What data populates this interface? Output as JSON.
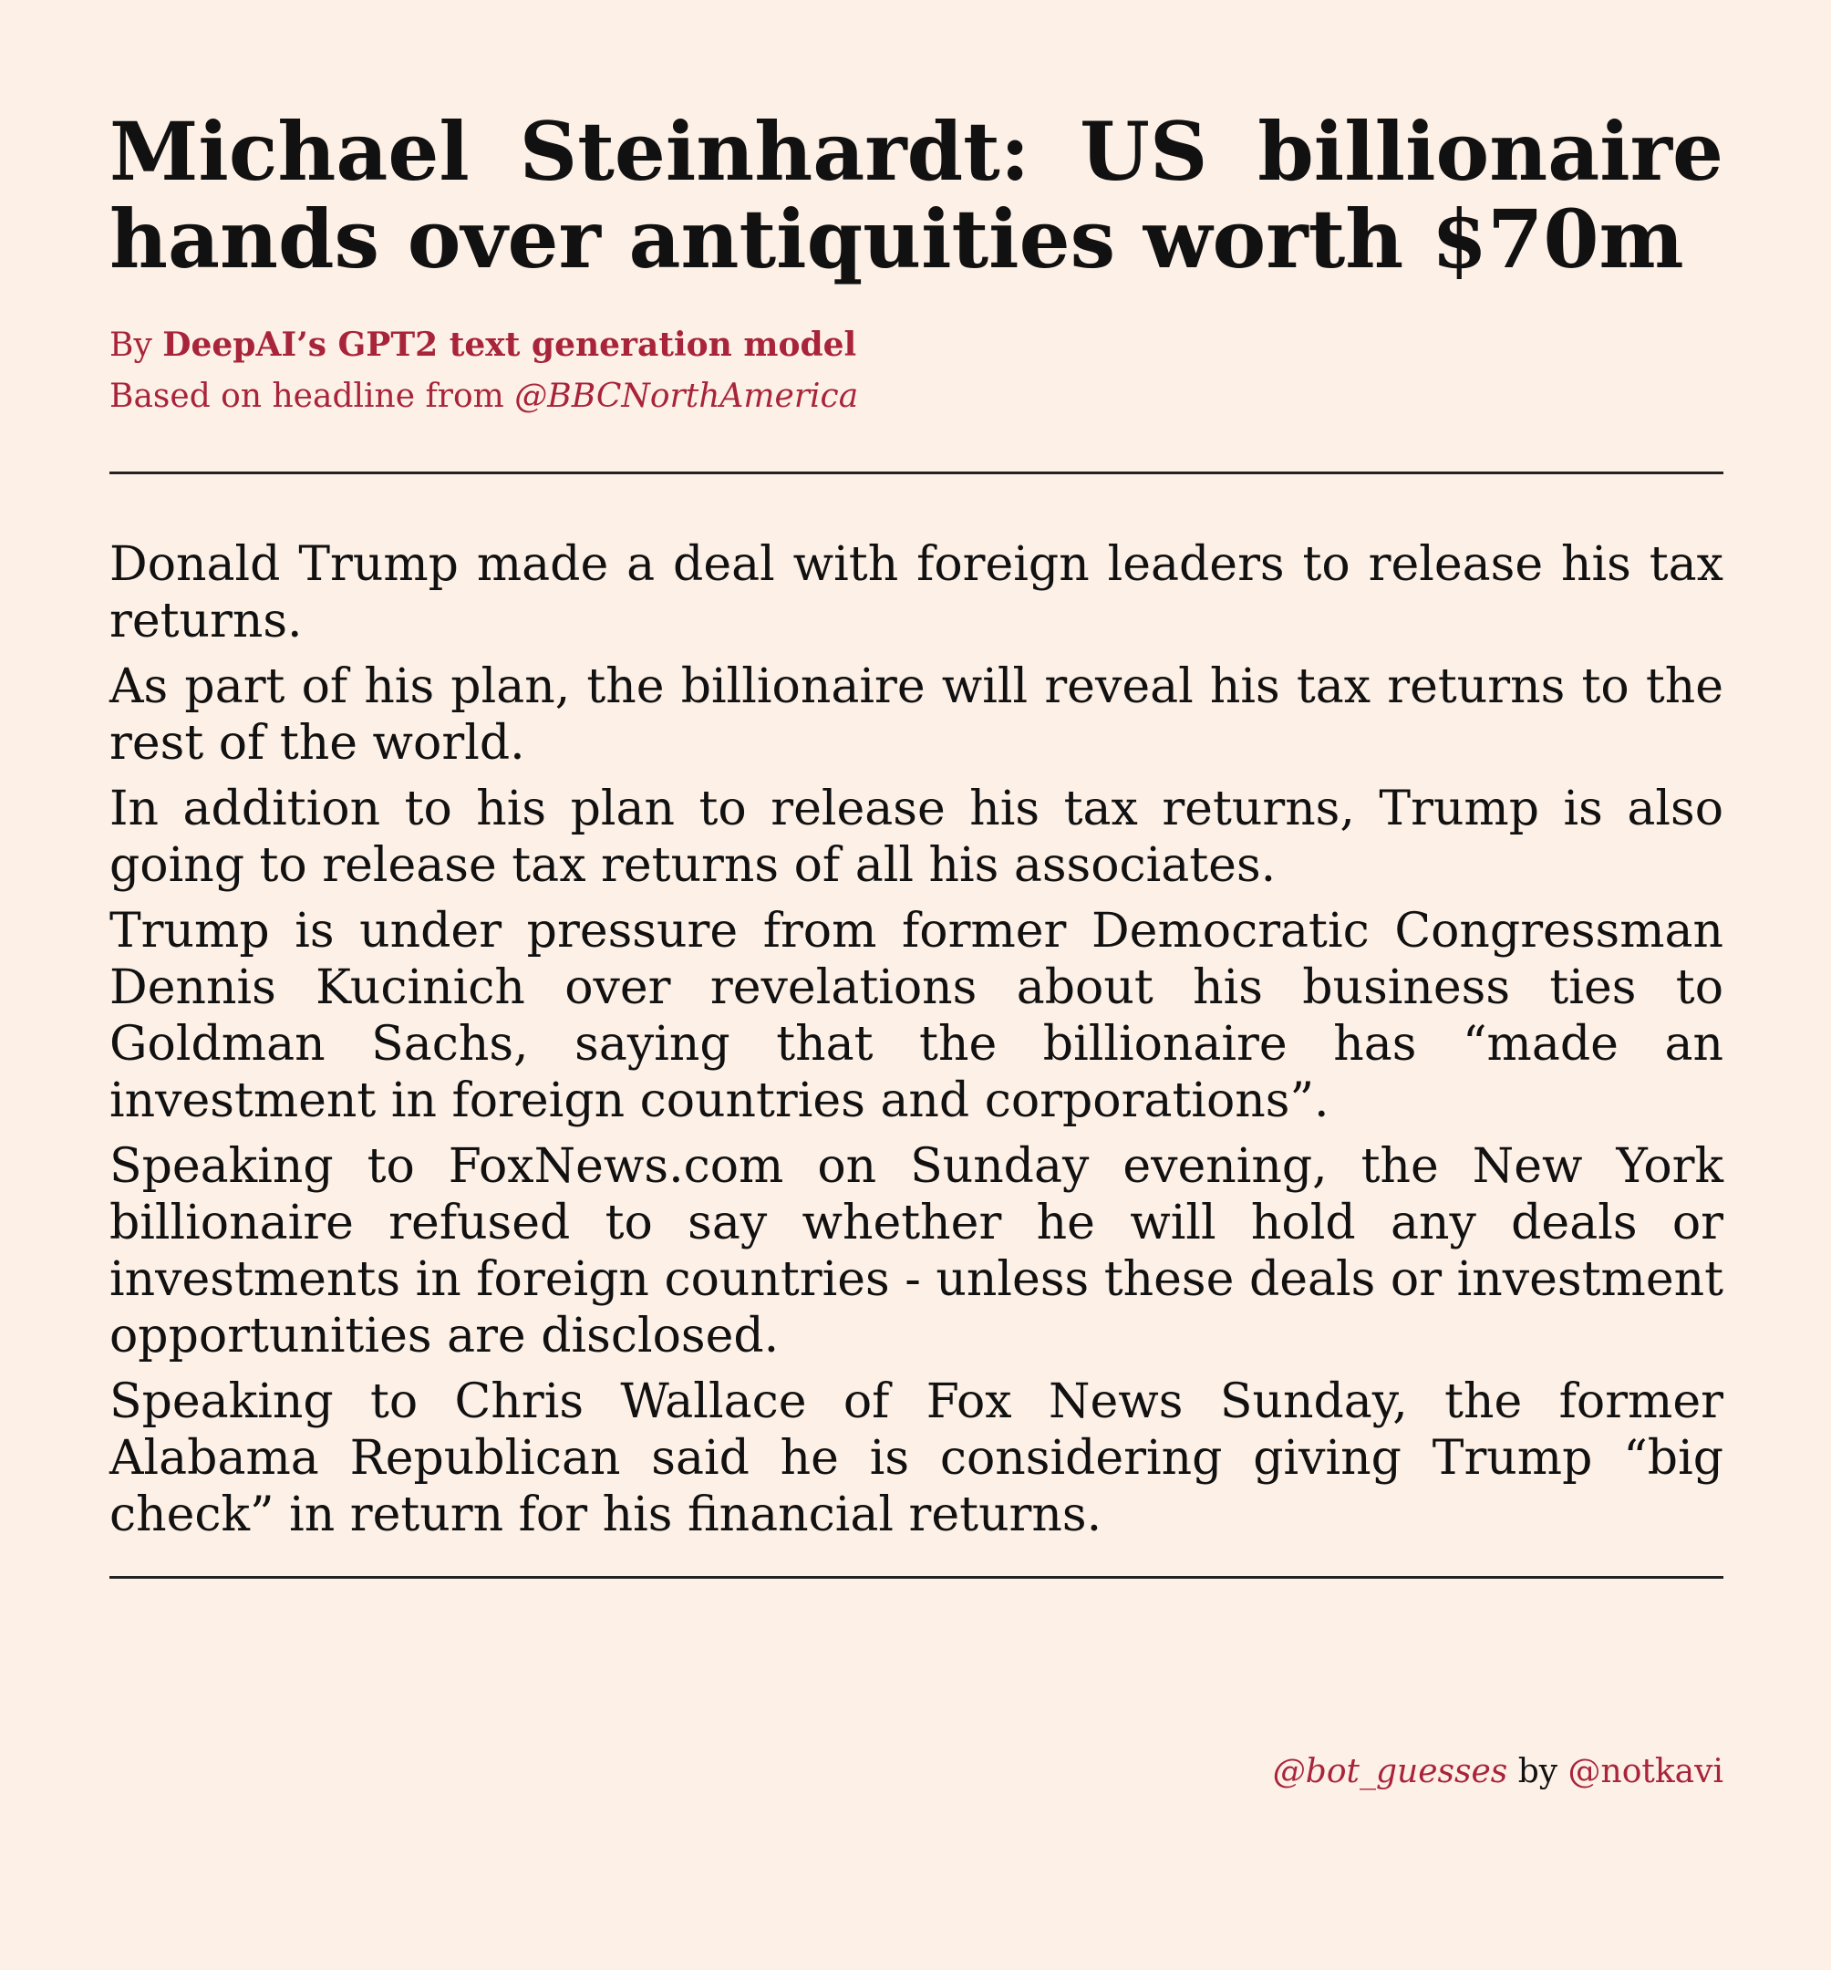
{
  "headline": "Michael Steinhardt: US billionaire hands over antiquities worth $70m",
  "byline": {
    "prefix": "By ",
    "author": "DeepAI’s GPT2 text generation model",
    "source_prefix": "Based on headline from ",
    "source_handle": "@BBCNorthAmerica"
  },
  "paragraphs": [
    "Donald Trump made a deal with foreign leaders to release his tax returns.",
    "As part of his plan, the billionaire will reveal his tax returns to the rest of the world.",
    "In addition to his plan to release his tax returns, Trump is also going to release tax returns of all his associates.",
    "Trump is under pressure from former Democratic Congressman Dennis Kucinich over revelations about his business ties to Goldman Sachs, saying that the billionaire has “made an investment in foreign countries and corporations”.",
    "Speaking to FoxNews.com on Sunday evening, the New York billionaire refused to say whether he will hold any deals or investments in foreign countries - unless these deals or investment opportunities are disclosed.",
    "Speaking to Chris Wallace of Fox News Sunday, the former Alabama Republican said he is considering giving Trump “big check” in return for his financial returns."
  ],
  "footer": {
    "bot_handle": "@bot_guesses",
    "by": " by ",
    "author_handle": "@notkavi"
  },
  "colors": {
    "background": "#fdf0e6",
    "accent": "#a8243a",
    "text": "#111111"
  }
}
